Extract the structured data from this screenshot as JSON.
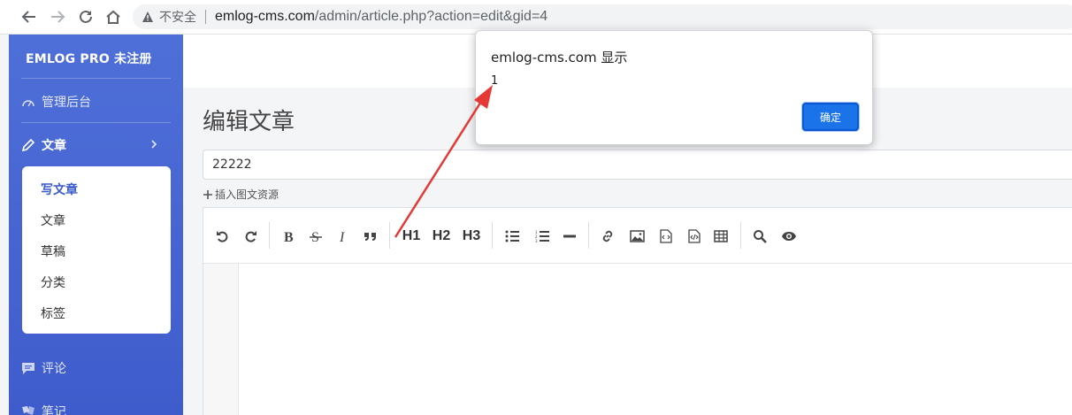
{
  "browser": {
    "security_label": "不安全",
    "url_host": "emlog-cms.com",
    "url_path": "/admin/article.php?action=edit&gid=4"
  },
  "sidebar": {
    "brand": "EMLOG PRO 未注册",
    "dashboard": "管理后台",
    "articles_section": "文章",
    "submenu": [
      "写文章",
      "文章",
      "草稿",
      "分类",
      "标签"
    ],
    "comments": "评论",
    "notes": "笔记"
  },
  "page": {
    "title": "编辑文章",
    "title_input_value": "22222",
    "insert_resource": "插入图文资源"
  },
  "editor": {
    "headings": [
      "H1",
      "H2",
      "H3"
    ]
  },
  "dialog": {
    "title": "emlog-cms.com 显示",
    "message": "1",
    "ok_label": "确定"
  },
  "colors": {
    "sidebar": "#4562d2",
    "accent": "#1a73e8",
    "arrow": "#e53935"
  }
}
